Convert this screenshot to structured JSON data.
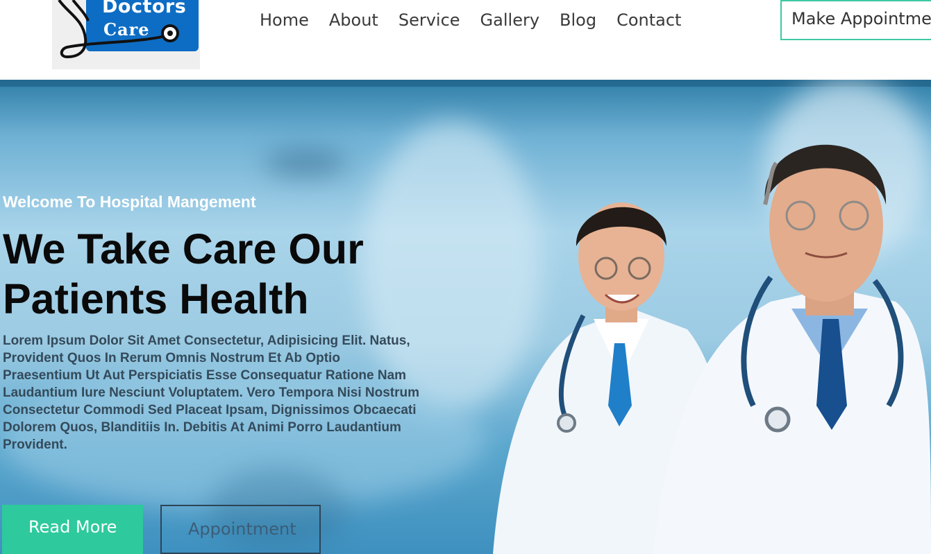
{
  "brand": {
    "line1": "Doctors",
    "line2": "Care",
    "color": "#0d6dc4"
  },
  "nav": {
    "items": [
      "Home",
      "About",
      "Service",
      "Gallery",
      "Blog",
      "Contact"
    ],
    "cta_label": "Make Appointment"
  },
  "hero": {
    "eyebrow": "Welcome To Hospital Mangement",
    "headline": "We Take Care Our Patients Health",
    "body": "Lorem Ipsum Dolor Sit Amet Consectetur, Adipisicing Elit. Natus, Provident Quos In Rerum Omnis Nostrum Et Ab Optio Praesentium Ut Aut Perspiciatis Esse Consequatur Ratione Nam Laudantium Iure Nesciunt Voluptatem. Vero Tempora Nisi Nostrum Consectetur Commodi Sed Placeat Ipsam, Dignissimos Obcaecati Dolorem Quos, Blanditiis In. Debitis At Animi Porro Laudantium Provident.",
    "read_more_label": "Read More",
    "appointment_label": "Appointment"
  },
  "colors": {
    "accent": "#2ec99c",
    "heading": "#0a0a0a",
    "hero_blue": "#6fb1d4"
  },
  "icons": [
    "stethoscope-icon"
  ]
}
